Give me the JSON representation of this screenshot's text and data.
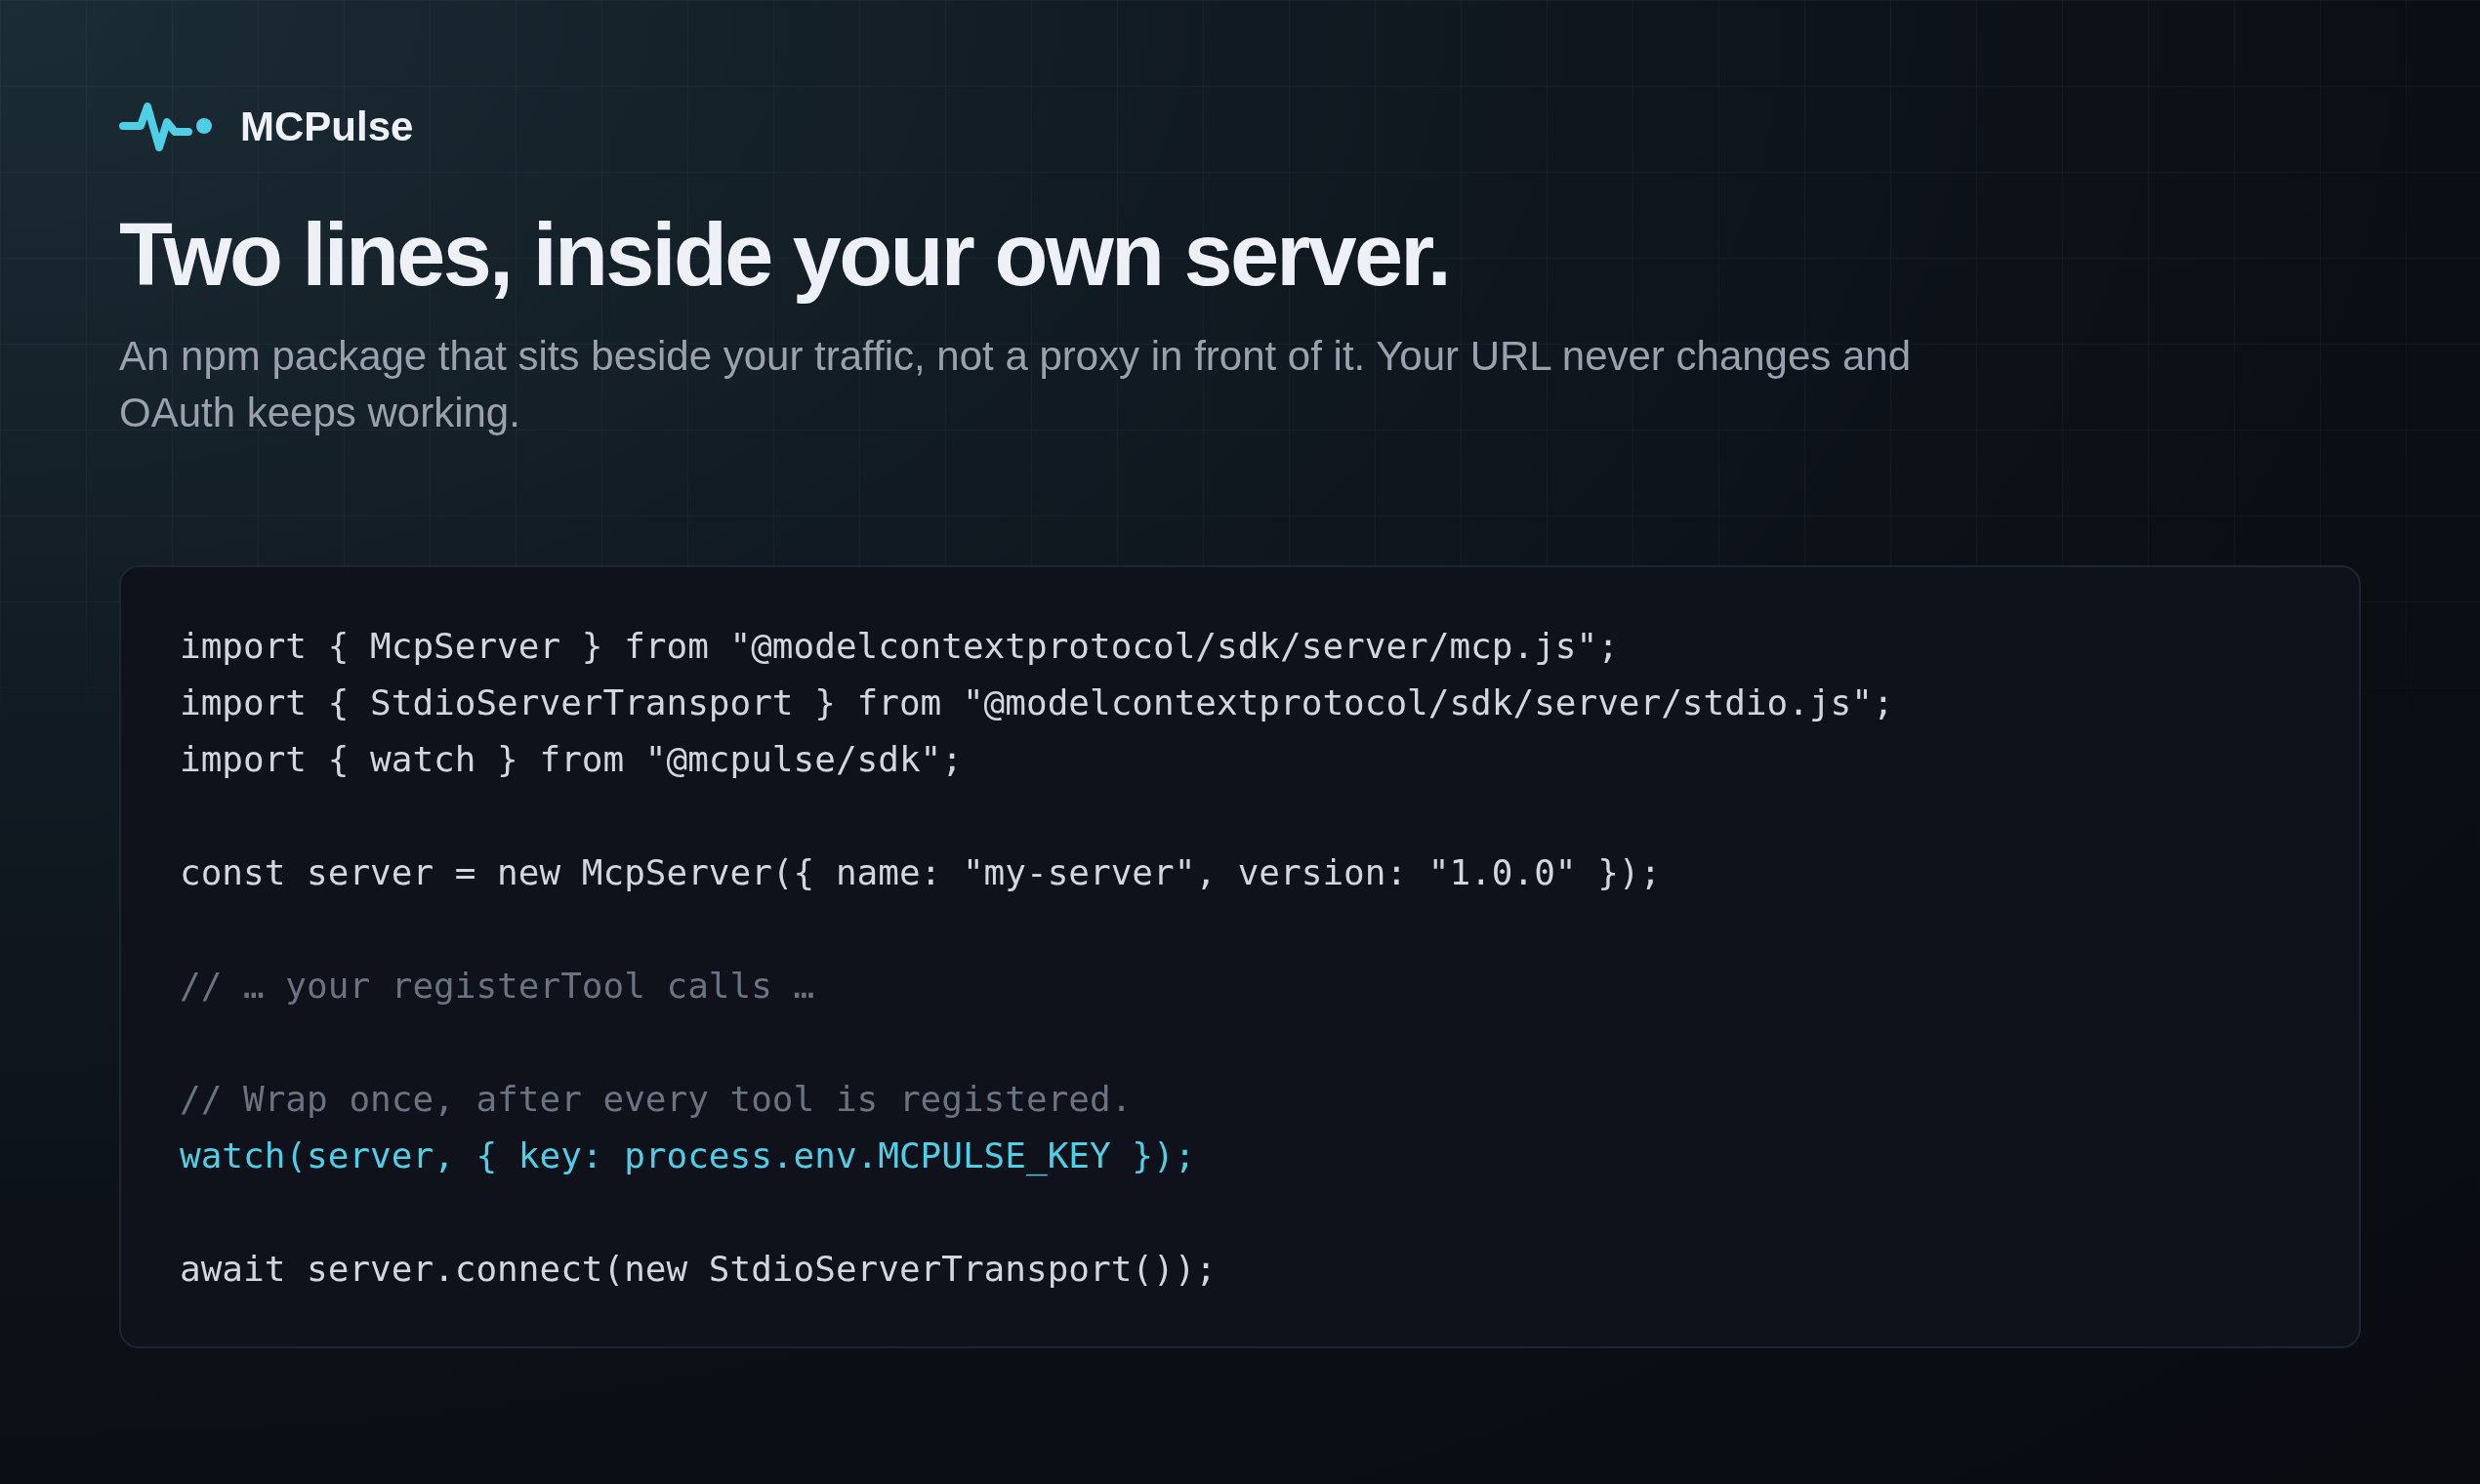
{
  "brand": {
    "name": "MCPulse"
  },
  "hero": {
    "title": "Two lines, inside your own server.",
    "subtitle": "An npm package that sits beside your traffic, not a proxy in front of it. Your URL never changes and OAuth keeps working."
  },
  "code_block": {
    "lines": [
      {
        "kind": "code",
        "text": "import { McpServer } from \"@modelcontextprotocol/sdk/server/mcp.js\";"
      },
      {
        "kind": "code",
        "text": "import { StdioServerTransport } from \"@modelcontextprotocol/sdk/server/stdio.js\";"
      },
      {
        "kind": "code",
        "text": "import { watch } from \"@mcpulse/sdk\";"
      },
      {
        "kind": "blank"
      },
      {
        "kind": "code",
        "text": "const server = new McpServer({ name: \"my-server\", version: \"1.0.0\" });"
      },
      {
        "kind": "blank"
      },
      {
        "kind": "comment",
        "text": "// … your registerTool calls …"
      },
      {
        "kind": "blank"
      },
      {
        "kind": "comment",
        "text": "// Wrap once, after every tool is registered."
      },
      {
        "kind": "highlight",
        "text": "watch(server, { key: process.env.MCPULSE_KEY });"
      },
      {
        "kind": "blank"
      },
      {
        "kind": "code",
        "text": "await server.connect(new StdioServerTransport());"
      }
    ]
  }
}
